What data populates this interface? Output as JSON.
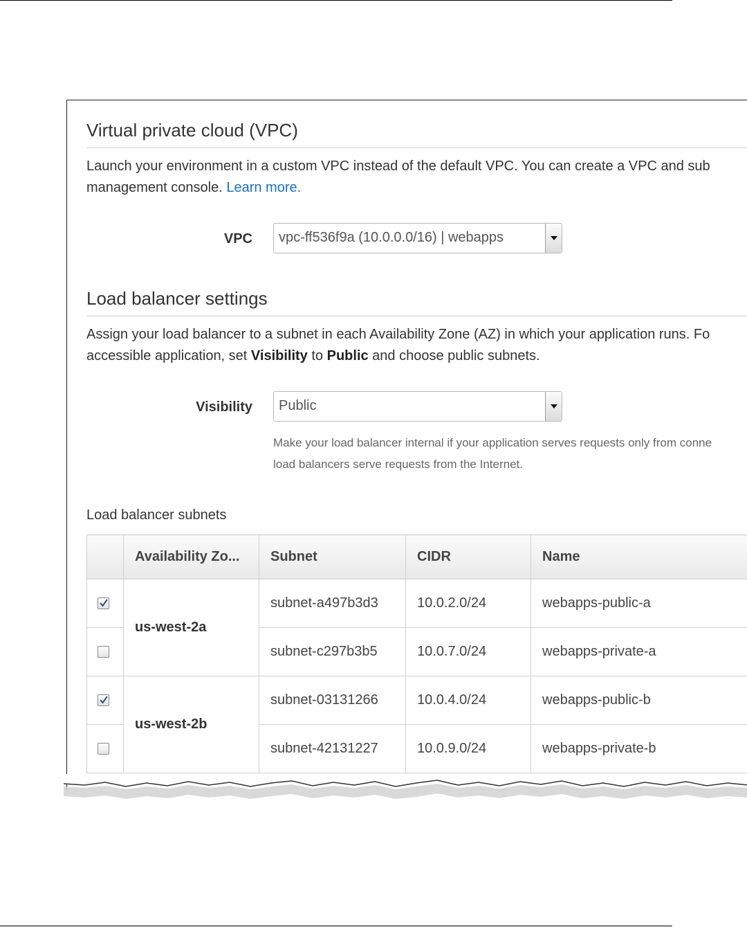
{
  "vpc_section": {
    "title": "Virtual private cloud (VPC)",
    "description_line1": "Launch your environment in a custom VPC instead of the default VPC. You can create a VPC and sub",
    "description_line2": "management console. ",
    "learn_more": "Learn more",
    "period": ".",
    "vpc_label": "VPC",
    "vpc_value": "vpc-ff536f9a (10.0.0.0/16) | webapps"
  },
  "lb_section": {
    "title": "Load balancer settings",
    "description_line1": "Assign your load balancer to a subnet in each Availability Zone (AZ) in which your application runs. Fo",
    "description_line2_a": "accessible application, set ",
    "description_line2_b": "Visibility",
    "description_line2_c": " to ",
    "description_line2_d": "Public",
    "description_line2_e": " and choose public subnets.",
    "visibility_label": "Visibility",
    "visibility_value": "Public",
    "help_line1": "Make your load balancer internal if your application serves requests only from conne",
    "help_line2": "load balancers serve requests from the Internet.",
    "subnets_label": "Load balancer subnets"
  },
  "subnets_table": {
    "headers": [
      "",
      "Availability Zo...",
      "Subnet",
      "CIDR",
      "Name"
    ],
    "groups": [
      {
        "az": "us-west-2a",
        "rows": [
          {
            "checked": true,
            "subnet": "subnet-a497b3d3",
            "cidr": "10.0.2.0/24",
            "name": "webapps-public-a"
          },
          {
            "checked": false,
            "subnet": "subnet-c297b3b5",
            "cidr": "10.0.7.0/24",
            "name": "webapps-private-a"
          }
        ]
      },
      {
        "az": "us-west-2b",
        "rows": [
          {
            "checked": true,
            "subnet": "subnet-03131266",
            "cidr": "10.0.4.0/24",
            "name": "webapps-public-b"
          },
          {
            "checked": false,
            "subnet": "subnet-42131227",
            "cidr": "10.0.9.0/24",
            "name": "webapps-private-b"
          }
        ]
      }
    ]
  },
  "colors": {
    "link": "#1a6fc4",
    "border": "#cfcfcf",
    "header_bg": "#e9e9e9"
  }
}
